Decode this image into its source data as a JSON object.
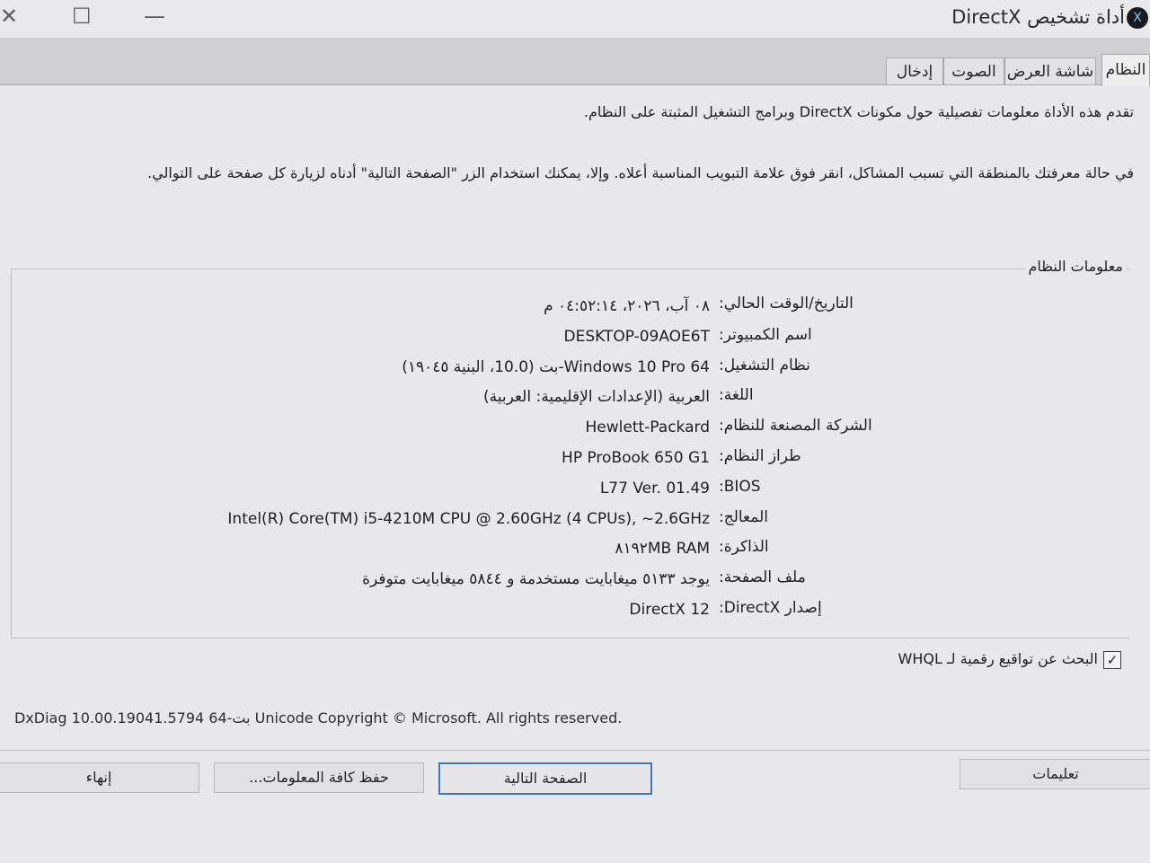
{
  "window": {
    "title": "أداة تشخيص DirectX",
    "close_glyph": "✕",
    "maximize_glyph": "☐",
    "minimize_glyph": "—",
    "title_icon_glyph": "X"
  },
  "tabs": [
    {
      "label": "النظام",
      "active": true
    },
    {
      "label": "شاشة العرض",
      "active": false
    },
    {
      "label": "الصوت",
      "active": false
    },
    {
      "label": "إدخال",
      "active": false
    }
  ],
  "intro": {
    "line1": "تقدم هذه الأداة معلومات تفصيلية حول مكونات DirectX وبرامج التشغيل المثبتة على النظام.",
    "line2": "في حالة معرفتك بالمنطقة التي تسبب المشاكل، انقر فوق علامة التبويب المناسبة أعلاه. وإلا، يمكنك استخدام الزر \"الصفحة التالية\" أدناه لزيارة كل صفحة على التوالي."
  },
  "system_info": {
    "group_label": "معلومات النظام",
    "rows": [
      {
        "label": "التاريخ/الوقت الحالي:",
        "value": "٠٨ آب، ٢٠٢٦، ٠٤:٥٢:١٤ م"
      },
      {
        "label": "اسم الكمبيوتر:",
        "value": "DESKTOP-09AOE6T"
      },
      {
        "label": "نظام التشغيل:",
        "value": "Windows 10 Pro 64-بت (10.0، البنية ١٩٠٤٥)"
      },
      {
        "label": "اللغة:",
        "value": "العربية (الإعدادات الإقليمية: العربية)"
      },
      {
        "label": "الشركة المصنعة للنظام:",
        "value": "Hewlett-Packard"
      },
      {
        "label": "طراز النظام:",
        "value": "HP ProBook 650 G1"
      },
      {
        "label": "BIOS:",
        "value": "L77 Ver. 01.49"
      },
      {
        "label": "المعالج:",
        "value": "Intel(R) Core(TM) i5-4210M CPU @ 2.60GHz (4 CPUs), ~2.6GHz"
      },
      {
        "label": "الذاكرة:",
        "value": "٨١٩٢MB RAM"
      },
      {
        "label": "ملف الصفحة:",
        "value": "يوجد ٥١٣٣ ميغابايت مستخدمة و ٥٨٤٤ ميغابايت متوفرة"
      },
      {
        "label": "إصدار DirectX:",
        "value": "DirectX 12"
      }
    ]
  },
  "whql": {
    "label": "البحث عن تواقيع رقمية لـ WHQL",
    "checked": true,
    "check_glyph": "✓"
  },
  "footer": {
    "copyright": "DxDiag 10.00.19041.5794 64-بت Unicode Copyright © Microsoft. All rights reserved."
  },
  "buttons": {
    "help": "تعليمات",
    "next": "الصفحة التالية",
    "save_all": "حفظ كافة المعلومات...",
    "exit": "إنهاء"
  },
  "colors": {
    "accent_border": "#3b78c2",
    "panel": "#e8e8ea"
  }
}
